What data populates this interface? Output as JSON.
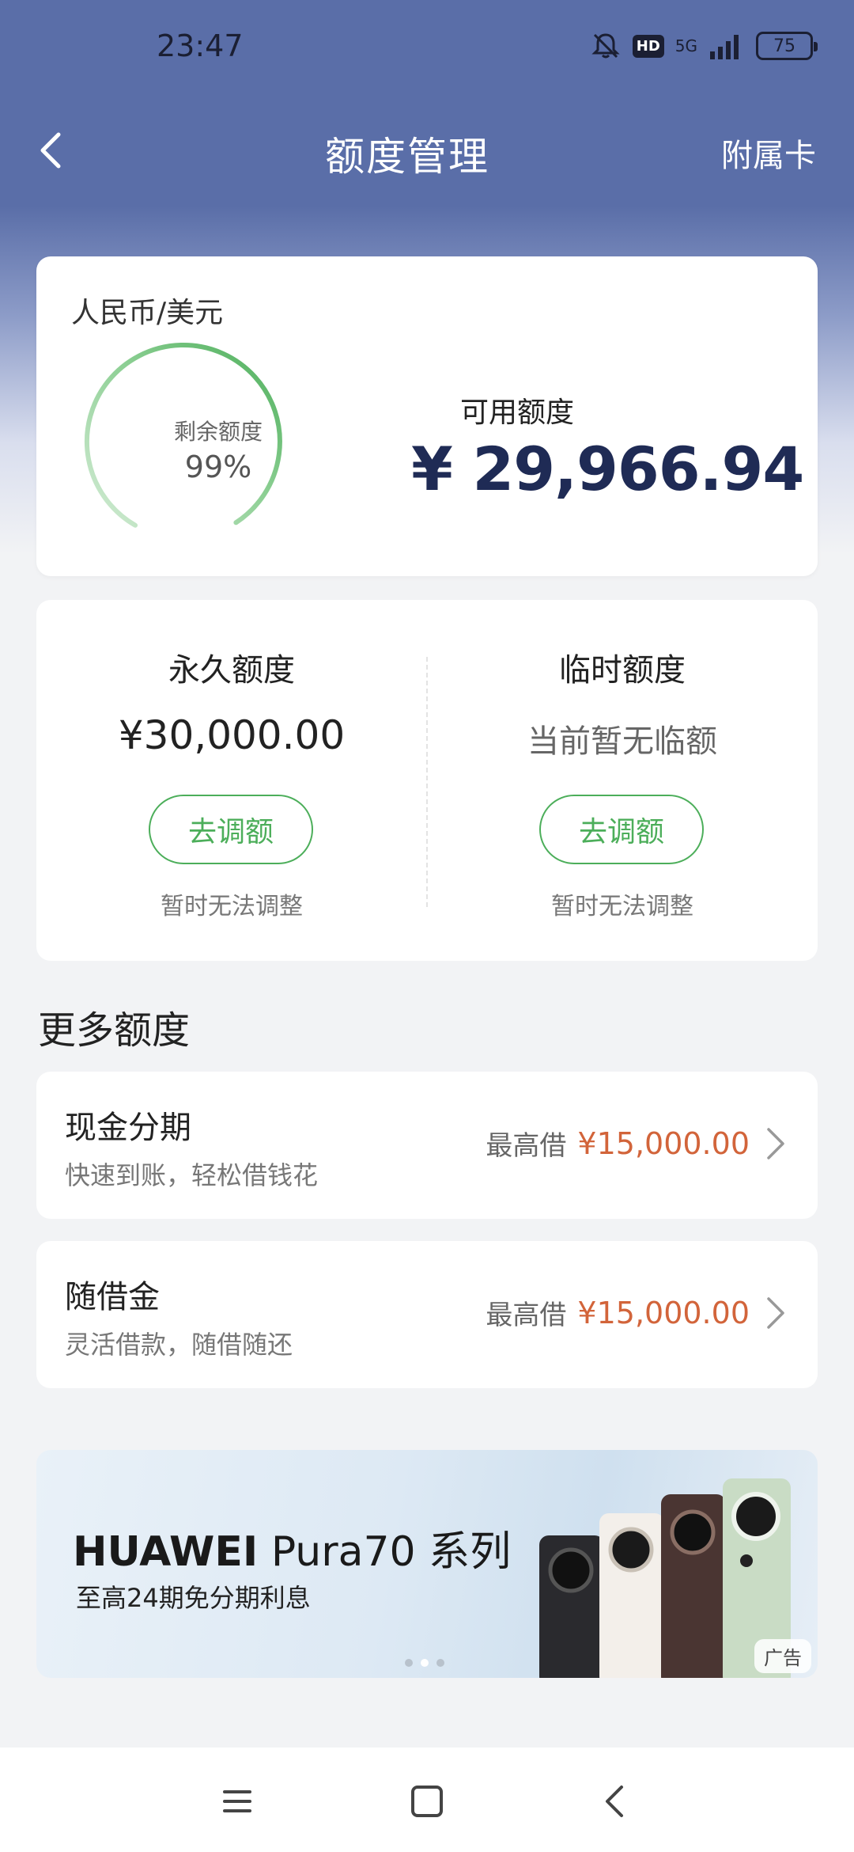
{
  "status_bar": {
    "time": "23:47",
    "hd_label": "HD",
    "network": "5G",
    "battery": "75",
    "icons": [
      "bell-off-icon",
      "signal-icon",
      "battery-icon"
    ]
  },
  "nav": {
    "title": "额度管理",
    "right_label": "附属卡",
    "back_icon": "chevron-left-icon"
  },
  "credit_summary": {
    "currency": "人民币/美元",
    "gauge_caption": "剩余额度",
    "gauge_percent": "99%",
    "gauge_fraction": 0.99,
    "available_label": "可用额度",
    "available_amount": "¥ 29,966.94"
  },
  "limits": {
    "permanent": {
      "title": "永久额度",
      "amount": "¥30,000.00",
      "button": "去调额",
      "note": "暂时无法调整"
    },
    "temporary": {
      "title": "临时额度",
      "amount": "当前暂无临额",
      "button": "去调额",
      "note": "暂时无法调整"
    }
  },
  "more": {
    "section_title": "更多额度",
    "items": [
      {
        "title": "现金分期",
        "subtitle": "快速到账，轻松借钱花",
        "max_label": "最高借",
        "max_amount": "¥15,000.00"
      },
      {
        "title": "随借金",
        "subtitle": "灵活借款，随借随还",
        "max_label": "最高借",
        "max_amount": "¥15,000.00"
      }
    ]
  },
  "banner": {
    "brand": "HUAWEI",
    "title_rest": "Pura70 系列",
    "subtitle": "至高24期免分期利息",
    "ad_label": "广告",
    "dots": 3,
    "active_dot": 1
  },
  "colors": {
    "header": "#5a6ea8",
    "accent_green": "#4cae5a",
    "amount_navy": "#1f2b55",
    "loan_orange": "#d2643a"
  }
}
